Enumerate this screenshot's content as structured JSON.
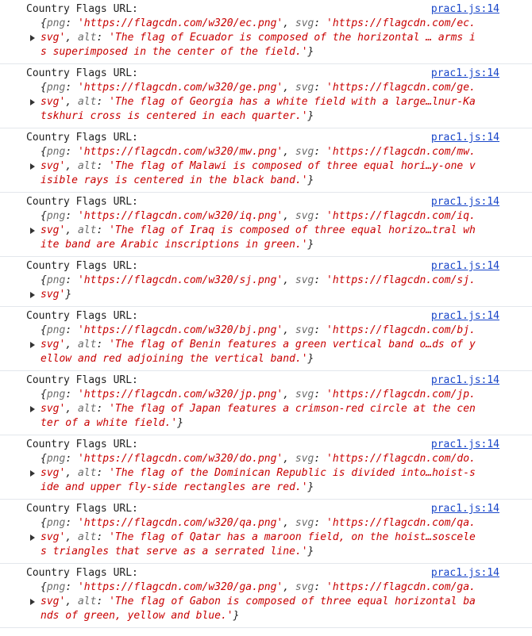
{
  "console": {
    "entries": [
      {
        "label": "Country Flags URL:",
        "source": "prac1.js:14",
        "lines": [
          [
            [
              "punc",
              "{"
            ],
            [
              "key",
              "png"
            ],
            [
              "punc",
              ": "
            ],
            [
              "str",
              "'https://flagcdn.com/w320/ec.png'"
            ],
            [
              "punc",
              ", "
            ],
            [
              "key",
              "svg"
            ],
            [
              "punc",
              ": "
            ],
            [
              "str",
              "'https://flagcdn.com/ec."
            ]
          ],
          [
            [
              "str",
              "svg'"
            ],
            [
              "punc",
              ", "
            ],
            [
              "key",
              "alt"
            ],
            [
              "punc",
              ": "
            ],
            [
              "str",
              "'The flag of Ecuador is composed of the horizontal … arms i"
            ]
          ],
          [
            [
              "str",
              "s superimposed in the center of the field.'"
            ],
            [
              "punc",
              "}"
            ]
          ]
        ]
      },
      {
        "label": "Country Flags URL:",
        "source": "prac1.js:14",
        "lines": [
          [
            [
              "punc",
              "{"
            ],
            [
              "key",
              "png"
            ],
            [
              "punc",
              ": "
            ],
            [
              "str",
              "'https://flagcdn.com/w320/ge.png'"
            ],
            [
              "punc",
              ", "
            ],
            [
              "key",
              "svg"
            ],
            [
              "punc",
              ": "
            ],
            [
              "str",
              "'https://flagcdn.com/ge."
            ]
          ],
          [
            [
              "str",
              "svg'"
            ],
            [
              "punc",
              ", "
            ],
            [
              "key",
              "alt"
            ],
            [
              "punc",
              ": "
            ],
            [
              "str",
              "'The flag of Georgia has a white field with a large…lnur-Ka"
            ]
          ],
          [
            [
              "str",
              "tskhuri cross is centered in each quarter.'"
            ],
            [
              "punc",
              "}"
            ]
          ]
        ]
      },
      {
        "label": "Country Flags URL:",
        "source": "prac1.js:14",
        "lines": [
          [
            [
              "punc",
              "{"
            ],
            [
              "key",
              "png"
            ],
            [
              "punc",
              ": "
            ],
            [
              "str",
              "'https://flagcdn.com/w320/mw.png'"
            ],
            [
              "punc",
              ", "
            ],
            [
              "key",
              "svg"
            ],
            [
              "punc",
              ": "
            ],
            [
              "str",
              "'https://flagcdn.com/mw."
            ]
          ],
          [
            [
              "str",
              "svg'"
            ],
            [
              "punc",
              ", "
            ],
            [
              "key",
              "alt"
            ],
            [
              "punc",
              ": "
            ],
            [
              "str",
              "'The flag of Malawi is composed of three equal hori…y-one v"
            ]
          ],
          [
            [
              "str",
              "isible rays is centered in the black band.'"
            ],
            [
              "punc",
              "}"
            ]
          ]
        ]
      },
      {
        "label": "Country Flags URL:",
        "source": "prac1.js:14",
        "lines": [
          [
            [
              "punc",
              "{"
            ],
            [
              "key",
              "png"
            ],
            [
              "punc",
              ": "
            ],
            [
              "str",
              "'https://flagcdn.com/w320/iq.png'"
            ],
            [
              "punc",
              ", "
            ],
            [
              "key",
              "svg"
            ],
            [
              "punc",
              ": "
            ],
            [
              "str",
              "'https://flagcdn.com/iq."
            ]
          ],
          [
            [
              "str",
              "svg'"
            ],
            [
              "punc",
              ", "
            ],
            [
              "key",
              "alt"
            ],
            [
              "punc",
              ": "
            ],
            [
              "str",
              "'The flag of Iraq is composed of three equal horizo…tral wh"
            ]
          ],
          [
            [
              "str",
              "ite band are Arabic inscriptions in green.'"
            ],
            [
              "punc",
              "}"
            ]
          ]
        ]
      },
      {
        "label": "Country Flags URL:",
        "source": "prac1.js:14",
        "lines": [
          [
            [
              "punc",
              "{"
            ],
            [
              "key",
              "png"
            ],
            [
              "punc",
              ": "
            ],
            [
              "str",
              "'https://flagcdn.com/w320/sj.png'"
            ],
            [
              "punc",
              ", "
            ],
            [
              "key",
              "svg"
            ],
            [
              "punc",
              ": "
            ],
            [
              "str",
              "'https://flagcdn.com/sj."
            ]
          ],
          [
            [
              "str",
              "svg'"
            ],
            [
              "punc",
              "}"
            ]
          ]
        ]
      },
      {
        "label": "Country Flags URL:",
        "source": "prac1.js:14",
        "lines": [
          [
            [
              "punc",
              "{"
            ],
            [
              "key",
              "png"
            ],
            [
              "punc",
              ": "
            ],
            [
              "str",
              "'https://flagcdn.com/w320/bj.png'"
            ],
            [
              "punc",
              ", "
            ],
            [
              "key",
              "svg"
            ],
            [
              "punc",
              ": "
            ],
            [
              "str",
              "'https://flagcdn.com/bj."
            ]
          ],
          [
            [
              "str",
              "svg'"
            ],
            [
              "punc",
              ", "
            ],
            [
              "key",
              "alt"
            ],
            [
              "punc",
              ": "
            ],
            [
              "str",
              "'The flag of Benin features a green vertical band o…ds of y"
            ]
          ],
          [
            [
              "str",
              "ellow and red adjoining the vertical band.'"
            ],
            [
              "punc",
              "}"
            ]
          ]
        ]
      },
      {
        "label": "Country Flags URL:",
        "source": "prac1.js:14",
        "lines": [
          [
            [
              "punc",
              "{"
            ],
            [
              "key",
              "png"
            ],
            [
              "punc",
              ": "
            ],
            [
              "str",
              "'https://flagcdn.com/w320/jp.png'"
            ],
            [
              "punc",
              ", "
            ],
            [
              "key",
              "svg"
            ],
            [
              "punc",
              ": "
            ],
            [
              "str",
              "'https://flagcdn.com/jp."
            ]
          ],
          [
            [
              "str",
              "svg'"
            ],
            [
              "punc",
              ", "
            ],
            [
              "key",
              "alt"
            ],
            [
              "punc",
              ": "
            ],
            [
              "str",
              "'The flag of Japan features a crimson-red circle at the cen"
            ]
          ],
          [
            [
              "str",
              "ter of a white field.'"
            ],
            [
              "punc",
              "}"
            ]
          ]
        ]
      },
      {
        "label": "Country Flags URL:",
        "source": "prac1.js:14",
        "lines": [
          [
            [
              "punc",
              "{"
            ],
            [
              "key",
              "png"
            ],
            [
              "punc",
              ": "
            ],
            [
              "str",
              "'https://flagcdn.com/w320/do.png'"
            ],
            [
              "punc",
              ", "
            ],
            [
              "key",
              "svg"
            ],
            [
              "punc",
              ": "
            ],
            [
              "str",
              "'https://flagcdn.com/do."
            ]
          ],
          [
            [
              "str",
              "svg'"
            ],
            [
              "punc",
              ", "
            ],
            [
              "key",
              "alt"
            ],
            [
              "punc",
              ": "
            ],
            [
              "str",
              "'The flag of the Dominican Republic is divided into…hoist-s"
            ]
          ],
          [
            [
              "str",
              "ide and upper fly-side rectangles are red.'"
            ],
            [
              "punc",
              "}"
            ]
          ]
        ]
      },
      {
        "label": "Country Flags URL:",
        "source": "prac1.js:14",
        "lines": [
          [
            [
              "punc",
              "{"
            ],
            [
              "key",
              "png"
            ],
            [
              "punc",
              ": "
            ],
            [
              "str",
              "'https://flagcdn.com/w320/qa.png'"
            ],
            [
              "punc",
              ", "
            ],
            [
              "key",
              "svg"
            ],
            [
              "punc",
              ": "
            ],
            [
              "str",
              "'https://flagcdn.com/qa."
            ]
          ],
          [
            [
              "str",
              "svg'"
            ],
            [
              "punc",
              ", "
            ],
            [
              "key",
              "alt"
            ],
            [
              "punc",
              ": "
            ],
            [
              "str",
              "'The flag of Qatar has a maroon field, on the hoist…soscele"
            ]
          ],
          [
            [
              "str",
              "s triangles that serve as a serrated line.'"
            ],
            [
              "punc",
              "}"
            ]
          ]
        ]
      },
      {
        "label": "Country Flags URL:",
        "source": "prac1.js:14",
        "lines": [
          [
            [
              "punc",
              "{"
            ],
            [
              "key",
              "png"
            ],
            [
              "punc",
              ": "
            ],
            [
              "str",
              "'https://flagcdn.com/w320/ga.png'"
            ],
            [
              "punc",
              ", "
            ],
            [
              "key",
              "svg"
            ],
            [
              "punc",
              ": "
            ],
            [
              "str",
              "'https://flagcdn.com/ga."
            ]
          ],
          [
            [
              "str",
              "svg'"
            ],
            [
              "punc",
              ", "
            ],
            [
              "key",
              "alt"
            ],
            [
              "punc",
              ": "
            ],
            [
              "str",
              "'The flag of Gabon is composed of three equal horizontal ba"
            ]
          ],
          [
            [
              "str",
              "nds of green, yellow and blue.'"
            ],
            [
              "punc",
              "}"
            ]
          ]
        ]
      }
    ]
  }
}
